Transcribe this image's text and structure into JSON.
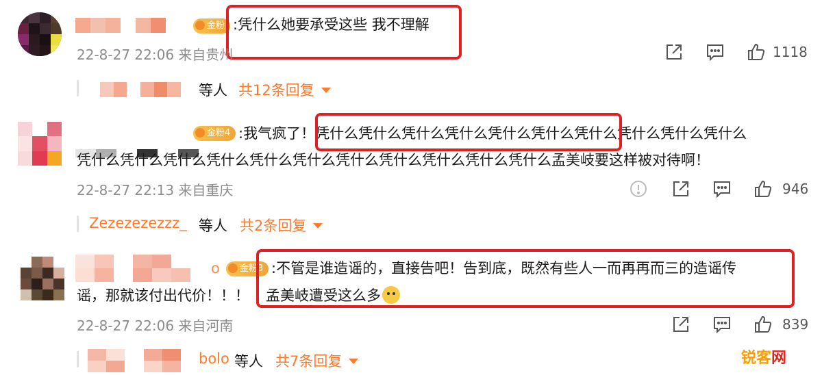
{
  "comments": [
    {
      "badge": "金粉",
      "text": ":凭什么她要承受这些 我不理解",
      "meta": "22-8-27 22:06 来自贵州",
      "likes": "1118",
      "reply_by": "等人",
      "reply_link": "共12条回复"
    },
    {
      "badge": "金粉4",
      "text_line1": ":我气疯了！凭什么凭什么凭什么凭什么凭什么凭什么凭什么凭什么凭什么凭什么",
      "text_line2": "凭什么凭什么凭什么凭什么凭什么凭什么凭什么凭什么凭什么凭什么凭什么孟美岐要这样被对待啊！",
      "meta": "22-8-27 22:13 来自重庆",
      "likes": "946",
      "reply_user": "Zezezezezzz_",
      "reply_by": "等人",
      "reply_link": "共2条回复"
    },
    {
      "badge": "金粉3",
      "name_suffix": "o",
      "text_line1": ":不管是谁造谣的，直接告吧！告到底，既然有些人一而再再而三的造谣传",
      "text_line2a": "谣，那就该付出代价！！！",
      "text_line2b": "孟美岐遭受这么多",
      "meta": "22-8-27 22:06 来自河南",
      "likes": "839",
      "reply_user": "bolo",
      "reply_by": "等人",
      "reply_link": "共7条回复"
    }
  ],
  "watermark": {
    "a": "锐客",
    "b": "网"
  },
  "icons": [
    "share-icon",
    "comment-icon",
    "like-icon",
    "report-icon"
  ],
  "colors": {
    "accent": "#ff7a2a",
    "highlight": "#e02020",
    "meta": "#8c8c8c"
  }
}
